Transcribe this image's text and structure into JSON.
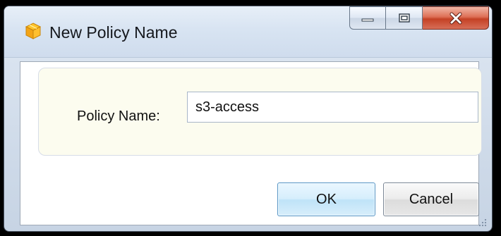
{
  "window": {
    "title": "New Policy Name",
    "icon": "package-icon",
    "title_color": "#15181d",
    "close_button_color": "#c44125"
  },
  "title_bar_controls": [
    {
      "name": "minimize-button",
      "icon": "minimize-icon"
    },
    {
      "name": "maximize-button",
      "icon": "maximize-icon"
    },
    {
      "name": "close-button",
      "icon": "close-icon"
    }
  ],
  "form": {
    "policy_name_label": "Policy Name:",
    "policy_name_value": "s3-access",
    "panel_background": "#fcfcef"
  },
  "buttons": {
    "ok_label": "OK",
    "cancel_label": "Cancel"
  }
}
